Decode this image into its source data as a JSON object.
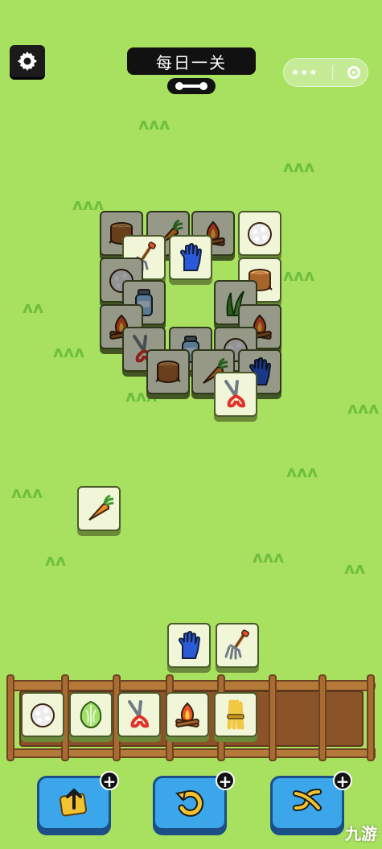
{
  "header": {
    "title": "每日一关"
  },
  "board": {
    "tiles": [
      {
        "id": "t1",
        "icon": "stump-icon",
        "covered": true
      },
      {
        "id": "t2",
        "icon": "carrot-icon",
        "covered": true
      },
      {
        "id": "t3",
        "icon": "campfire-icon",
        "covered": true
      },
      {
        "id": "t4",
        "icon": "rice-ball-icon",
        "covered": false
      },
      {
        "id": "t5",
        "icon": "pitchfork-icon",
        "covered": false
      },
      {
        "id": "t6",
        "icon": "glove-icon",
        "covered": false
      },
      {
        "id": "t7",
        "icon": "rice-ball-icon",
        "covered": true
      },
      {
        "id": "t8",
        "icon": "stump-icon",
        "covered": false
      },
      {
        "id": "t9",
        "icon": "jar-icon",
        "covered": true
      },
      {
        "id": "t10",
        "icon": "grass-icon",
        "covered": true
      },
      {
        "id": "t11",
        "icon": "campfire-icon",
        "covered": true
      },
      {
        "id": "t12",
        "icon": "campfire-icon",
        "covered": true
      },
      {
        "id": "t13",
        "icon": "shears-icon",
        "covered": true
      },
      {
        "id": "t14",
        "icon": "jar-icon",
        "covered": true
      },
      {
        "id": "t15",
        "icon": "rice-ball-icon",
        "covered": true
      },
      {
        "id": "t16",
        "icon": "stump-icon",
        "covered": true
      },
      {
        "id": "t17",
        "icon": "carrot-icon",
        "covered": true
      },
      {
        "id": "t18",
        "icon": "glove-icon",
        "covered": true
      },
      {
        "id": "t19",
        "icon": "shears-icon",
        "covered": false
      }
    ],
    "loose": [
      {
        "id": "l1",
        "icon": "carrot-icon"
      },
      {
        "id": "l2",
        "icon": "glove-icon"
      },
      {
        "id": "l3",
        "icon": "pitchfork-icon"
      }
    ]
  },
  "tray": {
    "slots": [
      {
        "icon": "rice-ball-icon"
      },
      {
        "icon": "cabbage-icon"
      },
      {
        "icon": "shears-icon"
      },
      {
        "icon": "campfire-icon"
      },
      {
        "icon": "wheat-icon"
      }
    ],
    "capacity": 7
  },
  "buttons": [
    {
      "name": "move-out-button",
      "icon": "move-out-icon"
    },
    {
      "name": "undo-button",
      "icon": "undo-icon"
    },
    {
      "name": "shuffle-button",
      "icon": "shuffle-icon"
    }
  ],
  "watermark": "九游"
}
